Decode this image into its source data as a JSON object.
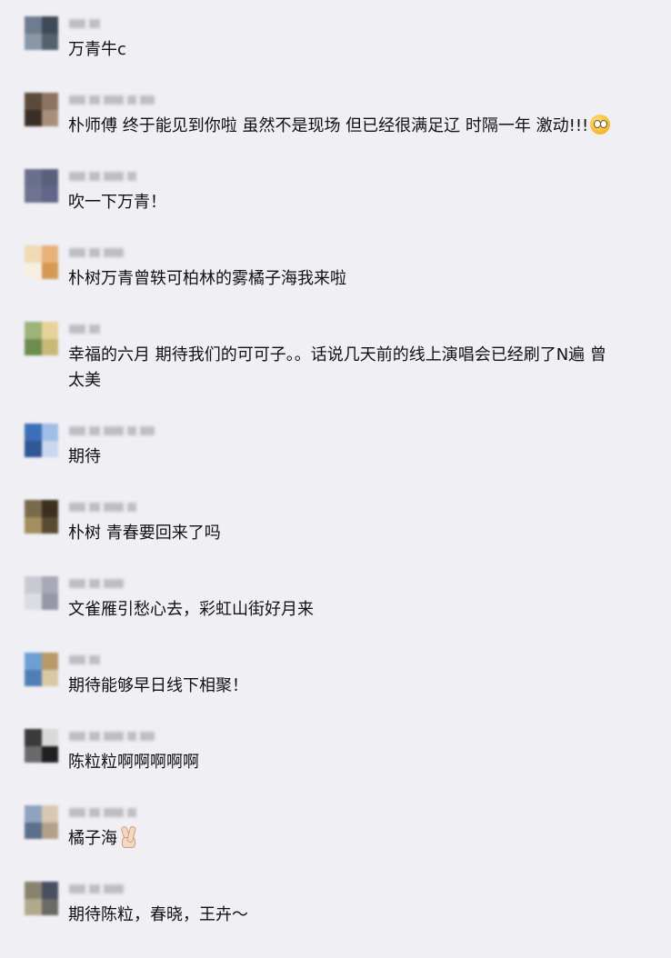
{
  "comments": [
    {
      "text": "万青牛c",
      "avatar_colors": [
        "#6d7c8e",
        "#3e4a58",
        "#8a97a6",
        "#55606d"
      ]
    },
    {
      "text": "朴师傅 终于能见到你啦 虽然不是现场 但已经很满足辽 时隔一年 激动!!!",
      "emoji": "dizzy-face-emoji",
      "avatar_colors": [
        "#5b4a3a",
        "#8e7460",
        "#3a2f28",
        "#a88f7a"
      ]
    },
    {
      "text": "吹一下万青！",
      "avatar_colors": [
        "#6a6f8c",
        "#5a5f7c",
        "#6e7390",
        "#61668a"
      ]
    },
    {
      "text": "朴树万青曾轶可柏林的雾橘子海我来啦",
      "avatar_colors": [
        "#f1d9b4",
        "#e8b27a",
        "#f7efe3",
        "#d49a55"
      ]
    },
    {
      "text": "幸福的六月 期待我们的可可子。。话说几天前的线上演唱会已经刷了N遍 曾\n太美",
      "avatar_colors": [
        "#9db37a",
        "#e7d39a",
        "#6f8c4f",
        "#c9b878"
      ]
    },
    {
      "text": "期待",
      "avatar_colors": [
        "#3d6fb8",
        "#9fbde6",
        "#2f5794",
        "#c8d8ef"
      ]
    },
    {
      "text": "朴树 青春要回来了吗",
      "avatar_colors": [
        "#7a6a4a",
        "#3b2f1e",
        "#a48d61",
        "#574a33"
      ]
    },
    {
      "text": "文雀雁引愁心去，彩虹山街好月来",
      "avatar_colors": [
        "#c9c9d2",
        "#a8a9b6",
        "#dcdce3",
        "#9598a6"
      ]
    },
    {
      "text": "期待能够早日线下相聚！",
      "avatar_colors": [
        "#6e9fd4",
        "#b89a68",
        "#4f7fb6",
        "#d8c9a4"
      ]
    },
    {
      "text": "陈粒粒啊啊啊啊啊",
      "avatar_colors": [
        "#3a3a3a",
        "#d9d9d9",
        "#6a6a6a",
        "#1f1f1f"
      ]
    },
    {
      "text": "橘子海",
      "emoji": "victory-hand-emoji",
      "avatar_colors": [
        "#8fa3bd",
        "#d9c7b3",
        "#5d6f8c",
        "#b59f88"
      ]
    },
    {
      "text": "期待陈粒，春晓，王卉～",
      "avatar_colors": [
        "#8a8270",
        "#4a4f60",
        "#b3a98f",
        "#6c6a66"
      ]
    }
  ]
}
